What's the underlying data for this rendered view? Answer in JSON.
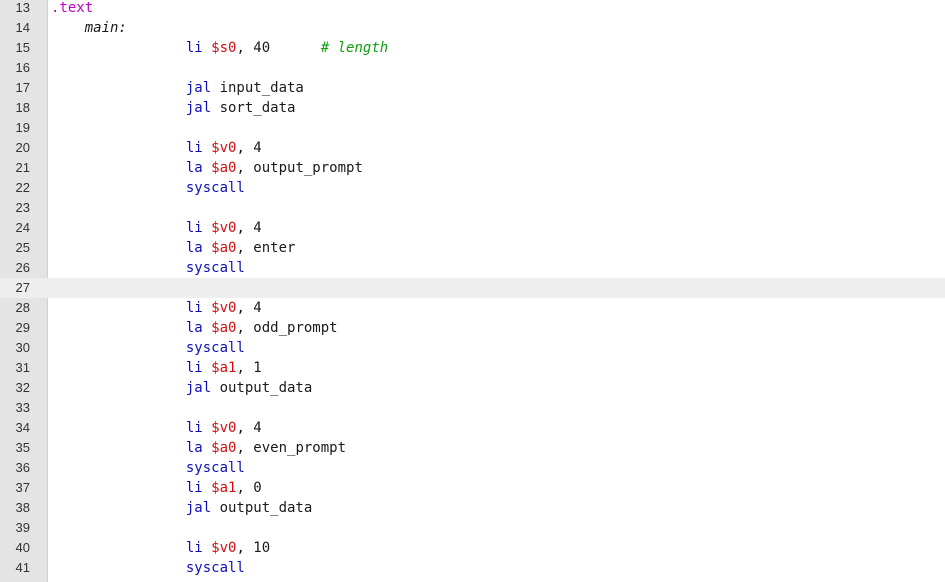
{
  "editor": {
    "current_line": 27,
    "colors": {
      "directive": "#c000c0",
      "mnemonic": "#1010b8",
      "register": "#d01010",
      "comment": "#10a010",
      "current_line_bg": "#eeeeee",
      "gutter_bg": "#e4e4e4"
    },
    "lines": [
      {
        "number": "13",
        "tokens": [
          {
            "t": "directive",
            "v": ".text"
          }
        ]
      },
      {
        "number": "14",
        "tokens": [
          {
            "t": "label",
            "v": "    main:"
          }
        ]
      },
      {
        "number": "15",
        "tokens": [
          {
            "t": "mnemonic",
            "v": "                li "
          },
          {
            "t": "register",
            "v": "$s0"
          },
          {
            "t": "plain",
            "v": ", 40      "
          },
          {
            "t": "comment",
            "v": "# length"
          }
        ]
      },
      {
        "number": "16",
        "tokens": []
      },
      {
        "number": "17",
        "tokens": [
          {
            "t": "mnemonic",
            "v": "                jal "
          },
          {
            "t": "plain",
            "v": "input_data"
          }
        ]
      },
      {
        "number": "18",
        "tokens": [
          {
            "t": "mnemonic",
            "v": "                jal "
          },
          {
            "t": "plain",
            "v": "sort_data"
          }
        ]
      },
      {
        "number": "19",
        "tokens": []
      },
      {
        "number": "20",
        "tokens": [
          {
            "t": "mnemonic",
            "v": "                li "
          },
          {
            "t": "register",
            "v": "$v0"
          },
          {
            "t": "plain",
            "v": ", 4"
          }
        ]
      },
      {
        "number": "21",
        "tokens": [
          {
            "t": "mnemonic",
            "v": "                la "
          },
          {
            "t": "register",
            "v": "$a0"
          },
          {
            "t": "plain",
            "v": ", output_prompt"
          }
        ]
      },
      {
        "number": "22",
        "tokens": [
          {
            "t": "mnemonic",
            "v": "                syscall"
          }
        ]
      },
      {
        "number": "23",
        "tokens": []
      },
      {
        "number": "24",
        "tokens": [
          {
            "t": "mnemonic",
            "v": "                li "
          },
          {
            "t": "register",
            "v": "$v0"
          },
          {
            "t": "plain",
            "v": ", 4"
          }
        ]
      },
      {
        "number": "25",
        "tokens": [
          {
            "t": "mnemonic",
            "v": "                la "
          },
          {
            "t": "register",
            "v": "$a0"
          },
          {
            "t": "plain",
            "v": ", enter"
          }
        ]
      },
      {
        "number": "26",
        "tokens": [
          {
            "t": "mnemonic",
            "v": "                syscall"
          }
        ]
      },
      {
        "number": "27",
        "tokens": []
      },
      {
        "number": "28",
        "tokens": [
          {
            "t": "mnemonic",
            "v": "                li "
          },
          {
            "t": "register",
            "v": "$v0"
          },
          {
            "t": "plain",
            "v": ", 4"
          }
        ]
      },
      {
        "number": "29",
        "tokens": [
          {
            "t": "mnemonic",
            "v": "                la "
          },
          {
            "t": "register",
            "v": "$a0"
          },
          {
            "t": "plain",
            "v": ", odd_prompt"
          }
        ]
      },
      {
        "number": "30",
        "tokens": [
          {
            "t": "mnemonic",
            "v": "                syscall"
          }
        ]
      },
      {
        "number": "31",
        "tokens": [
          {
            "t": "mnemonic",
            "v": "                li "
          },
          {
            "t": "register",
            "v": "$a1"
          },
          {
            "t": "plain",
            "v": ", 1"
          }
        ]
      },
      {
        "number": "32",
        "tokens": [
          {
            "t": "mnemonic",
            "v": "                jal "
          },
          {
            "t": "plain",
            "v": "output_data"
          }
        ]
      },
      {
        "number": "33",
        "tokens": []
      },
      {
        "number": "34",
        "tokens": [
          {
            "t": "mnemonic",
            "v": "                li "
          },
          {
            "t": "register",
            "v": "$v0"
          },
          {
            "t": "plain",
            "v": ", 4"
          }
        ]
      },
      {
        "number": "35",
        "tokens": [
          {
            "t": "mnemonic",
            "v": "                la "
          },
          {
            "t": "register",
            "v": "$a0"
          },
          {
            "t": "plain",
            "v": ", even_prompt"
          }
        ]
      },
      {
        "number": "36",
        "tokens": [
          {
            "t": "mnemonic",
            "v": "                syscall"
          }
        ]
      },
      {
        "number": "37",
        "tokens": [
          {
            "t": "mnemonic",
            "v": "                li "
          },
          {
            "t": "register",
            "v": "$a1"
          },
          {
            "t": "plain",
            "v": ", 0"
          }
        ]
      },
      {
        "number": "38",
        "tokens": [
          {
            "t": "mnemonic",
            "v": "                jal "
          },
          {
            "t": "plain",
            "v": "output_data"
          }
        ]
      },
      {
        "number": "39",
        "tokens": []
      },
      {
        "number": "40",
        "tokens": [
          {
            "t": "mnemonic",
            "v": "                li "
          },
          {
            "t": "register",
            "v": "$v0"
          },
          {
            "t": "plain",
            "v": ", 10"
          }
        ]
      },
      {
        "number": "41",
        "tokens": [
          {
            "t": "mnemonic",
            "v": "                syscall"
          }
        ]
      }
    ]
  }
}
